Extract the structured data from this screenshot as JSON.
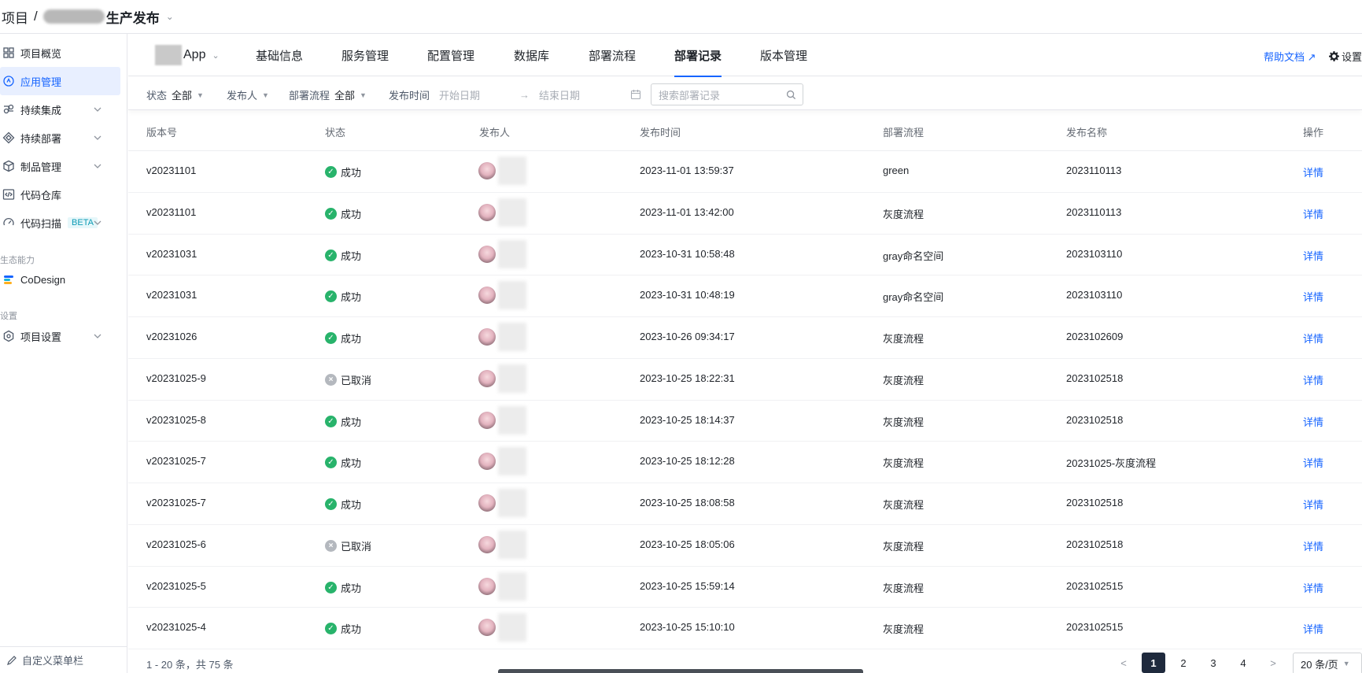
{
  "breadcrumb": {
    "root": "项目",
    "separator": "/",
    "current": "生产发布"
  },
  "sidebar": {
    "items": [
      {
        "label": "项目概览",
        "icon": "grid-icon"
      },
      {
        "label": "应用管理",
        "icon": "app-icon"
      },
      {
        "label": "持续集成",
        "icon": "integration-icon"
      },
      {
        "label": "持续部署",
        "icon": "deploy-icon"
      },
      {
        "label": "制品管理",
        "icon": "package-icon"
      },
      {
        "label": "代码仓库",
        "icon": "code-icon"
      },
      {
        "label": "代码扫描",
        "icon": "scan-icon",
        "badge": "BETA"
      }
    ],
    "group_ecosystem": "生态能力",
    "ecosystem_item": "CoDesign",
    "group_settings": "设置",
    "settings_item": "项目设置",
    "footer": "自定义菜单栏"
  },
  "appbar": {
    "app_name_suffix": "App",
    "tabs": [
      "基础信息",
      "服务管理",
      "配置管理",
      "数据库",
      "部署流程",
      "部署记录",
      "版本管理"
    ],
    "active_tab": "部署记录",
    "help": "帮助文档 ↗",
    "settings": "设置"
  },
  "filters": {
    "status_label": "状态",
    "status_value": "全部",
    "publisher_label": "发布人",
    "flow_label": "部署流程",
    "flow_value": "全部",
    "time_label": "发布时间",
    "start_placeholder": "开始日期",
    "end_placeholder": "结束日期",
    "arrow": "→",
    "search_placeholder": "搜索部署记录"
  },
  "table": {
    "columns": [
      "版本号",
      "状态",
      "发布人",
      "发布时间",
      "部署流程",
      "发布名称",
      "操作"
    ],
    "action_label": "详情",
    "rows": [
      {
        "version": "v20231101",
        "status": "成功",
        "ok": true,
        "time": "2023-11-01 13:59:37",
        "flow": "green",
        "name": "2023110113"
      },
      {
        "version": "v20231101",
        "status": "成功",
        "ok": true,
        "time": "2023-11-01 13:42:00",
        "flow": "灰度流程",
        "name": "2023110113"
      },
      {
        "version": "v20231031",
        "status": "成功",
        "ok": true,
        "time": "2023-10-31 10:58:48",
        "flow": "gray命名空间",
        "name": "2023103110"
      },
      {
        "version": "v20231031",
        "status": "成功",
        "ok": true,
        "time": "2023-10-31 10:48:19",
        "flow": "gray命名空间",
        "name": "2023103110"
      },
      {
        "version": "v20231026",
        "status": "成功",
        "ok": true,
        "time": "2023-10-26 09:34:17",
        "flow": "灰度流程",
        "name": "2023102609"
      },
      {
        "version": "v20231025-9",
        "status": "已取消",
        "ok": false,
        "time": "2023-10-25 18:22:31",
        "flow": "灰度流程",
        "name": "2023102518"
      },
      {
        "version": "v20231025-8",
        "status": "成功",
        "ok": true,
        "time": "2023-10-25 18:14:37",
        "flow": "灰度流程",
        "name": "2023102518"
      },
      {
        "version": "v20231025-7",
        "status": "成功",
        "ok": true,
        "time": "2023-10-25 18:12:28",
        "flow": "灰度流程",
        "name": "20231025-灰度流程"
      },
      {
        "version": "v20231025-7",
        "status": "成功",
        "ok": true,
        "time": "2023-10-25 18:08:58",
        "flow": "灰度流程",
        "name": "2023102518"
      },
      {
        "version": "v20231025-6",
        "status": "已取消",
        "ok": false,
        "time": "2023-10-25 18:05:06",
        "flow": "灰度流程",
        "name": "2023102518"
      },
      {
        "version": "v20231025-5",
        "status": "成功",
        "ok": true,
        "time": "2023-10-25 15:59:14",
        "flow": "灰度流程",
        "name": "2023102515"
      },
      {
        "version": "v20231025-4",
        "status": "成功",
        "ok": true,
        "time": "2023-10-25 15:10:10",
        "flow": "灰度流程",
        "name": "2023102515"
      }
    ]
  },
  "pagination": {
    "total_text": "1 - 20 条，共 75 条",
    "prev": "<",
    "pages": [
      "1",
      "2",
      "3",
      "4"
    ],
    "active_page": "1",
    "next": ">",
    "page_size": "20 条/页"
  },
  "colors": {
    "accent": "#1664ff",
    "success": "#28b36b",
    "cancelled": "#b4b8be"
  }
}
